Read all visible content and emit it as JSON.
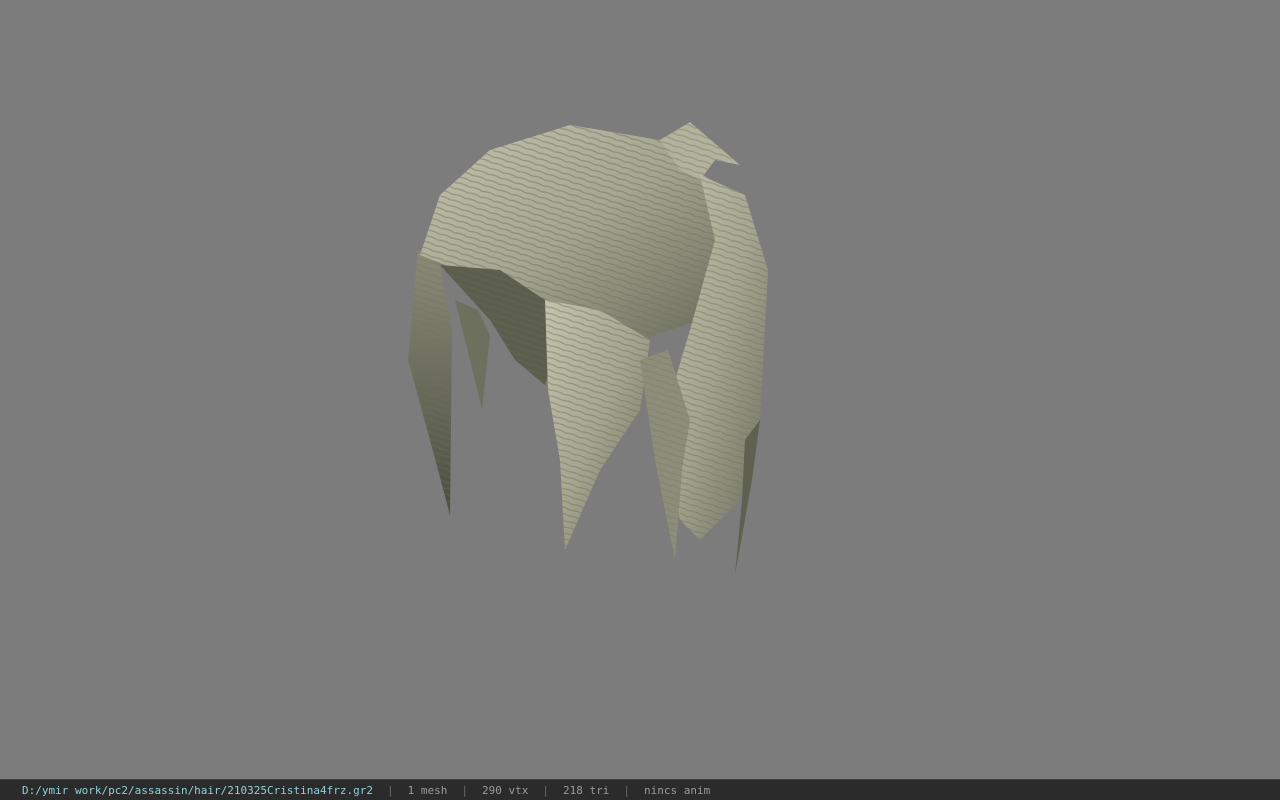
{
  "viewer": {
    "background_color": "#7c7c7c",
    "model": {
      "name": "hair-mesh",
      "base_color": "#a9a994",
      "shadow_color": "#4b4d40"
    }
  },
  "statusbar": {
    "file_path": "D:/ymir work/pc2/assassin/hair/210325Cristina4frz.gr2",
    "separator": "|",
    "mesh_count": "1 mesh",
    "vertex_count": "290 vtx",
    "triangle_count": "218 tri",
    "anim_status": "nincs anim",
    "path_color": "#8fd0d8"
  }
}
